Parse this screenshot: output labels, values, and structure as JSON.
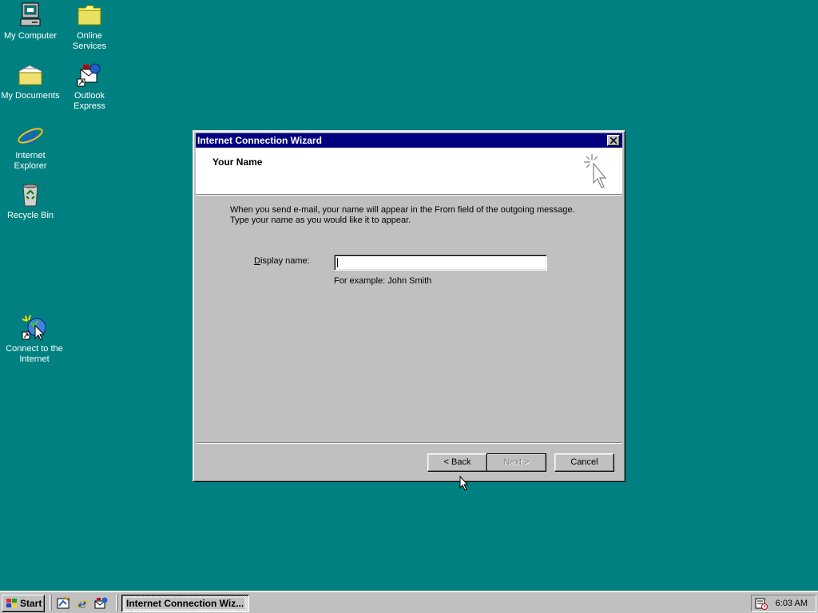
{
  "desktop": {
    "icons": [
      {
        "label_line1": "My Computer",
        "label_line2": ""
      },
      {
        "label_line1": "Online",
        "label_line2": "Services"
      },
      {
        "label_line1": "My Documents",
        "label_line2": ""
      },
      {
        "label_line1": "Outlook",
        "label_line2": "Express"
      },
      {
        "label_line1": "Internet",
        "label_line2": "Explorer"
      },
      {
        "label_line1": "Recycle Bin",
        "label_line2": ""
      },
      {
        "label_line1": "Connect to the",
        "label_line2": "Internet"
      }
    ]
  },
  "wizard": {
    "title": "Internet Connection Wizard",
    "header": "Your Name",
    "intro_line1": "When you send e-mail, your name will appear in the From field of the outgoing message.",
    "intro_line2": "Type your name as you would like it to appear.",
    "field_label_mnemonic": "D",
    "field_label_rest": "isplay name:",
    "field_value": "",
    "example": "For example: John Smith",
    "buttons": {
      "back": "< Back",
      "next": "Next >",
      "cancel": "Cancel"
    },
    "next_enabled": false
  },
  "taskbar": {
    "start_label": "Start",
    "task_label": "Internet Connection Wiz...",
    "clock": "6:03 AM",
    "quicklaunch_icons": [
      "desktop-icon",
      "internet-explorer-icon",
      "outlook-express-icon"
    ]
  },
  "colors": {
    "desktop": "#008080",
    "titlebar": "#000080",
    "face": "#c0c0c0"
  }
}
